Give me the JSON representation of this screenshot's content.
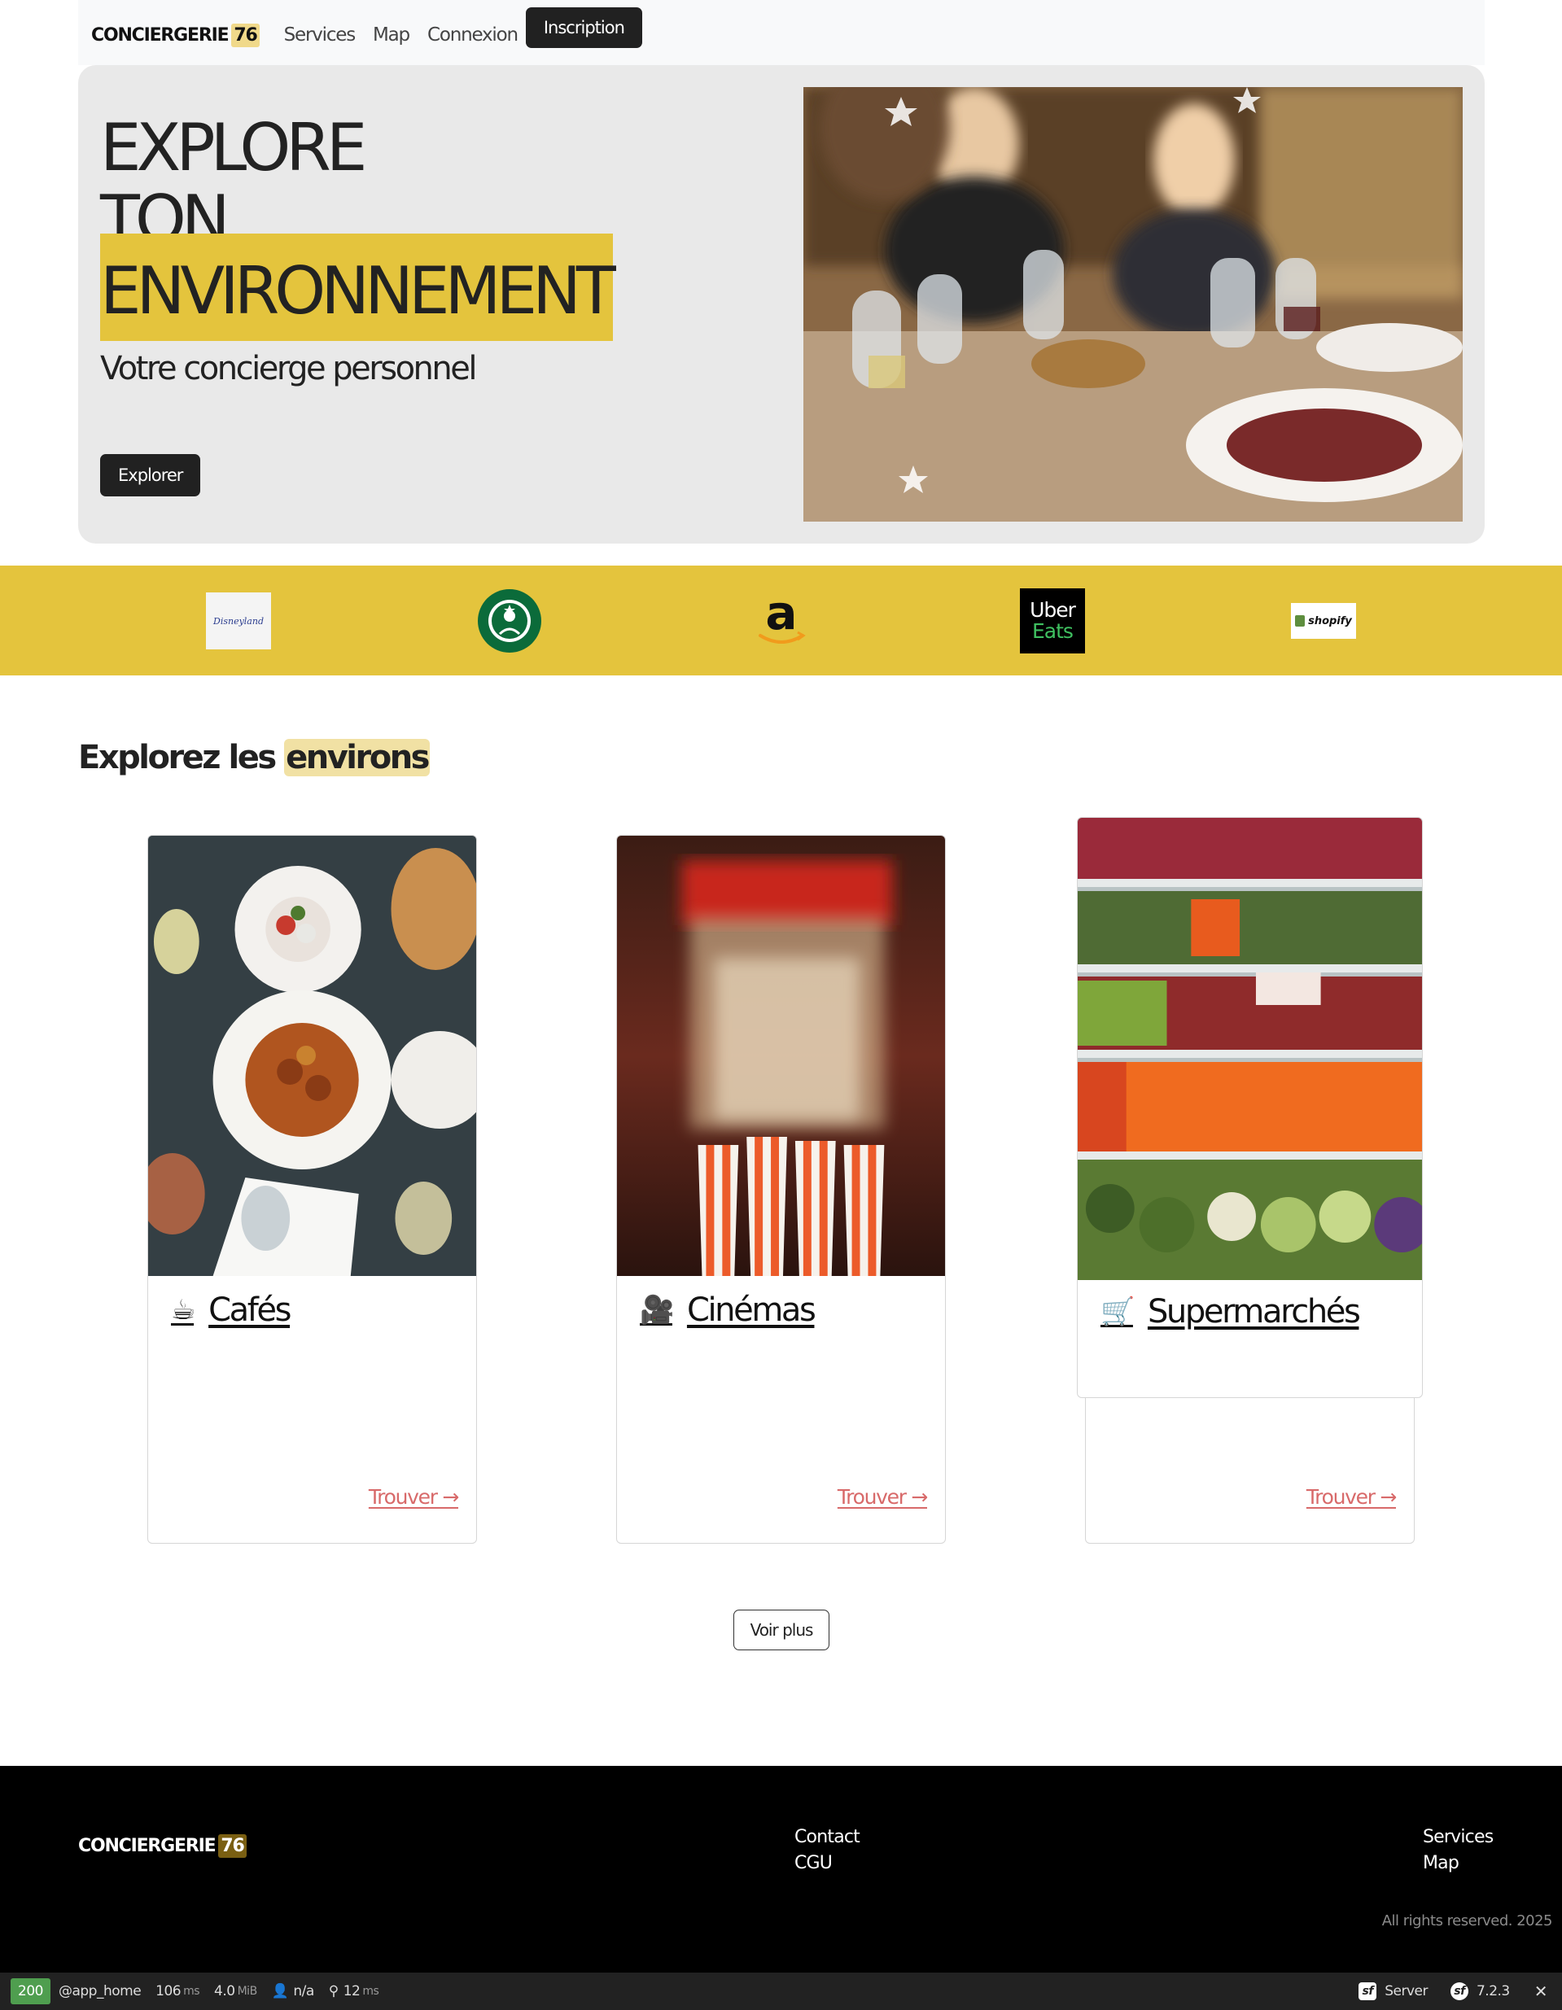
{
  "nav": {
    "brand": "CONCIERGERIE",
    "brand_badge": "76",
    "links": [
      "Services",
      "Map",
      "Connexion"
    ],
    "cta": "Inscription"
  },
  "hero": {
    "title_line1": "EXPLORE",
    "title_line2": "TON",
    "title_highlight": "ENVIRONNEMENT",
    "subtitle": "Votre concierge personnel",
    "button": "Explorer"
  },
  "partners": {
    "amazon": "a",
    "uber_line1": "Uber",
    "uber_line2": "Eats",
    "shopify": "shopify",
    "disneyland": "Disneyland"
  },
  "explore": {
    "title_prefix": "Explorez les",
    "title_highlight": "environs",
    "cards": [
      {
        "icon": "☕",
        "title": "Cafés",
        "link": "Trouver →"
      },
      {
        "icon": "🎥",
        "title": "Cinémas",
        "link": "Trouver →"
      },
      {
        "icon": "🛒",
        "title": "Supermarchés",
        "link": "Trouver →"
      }
    ],
    "more": "Voir plus"
  },
  "footer": {
    "brand": "CONCIERGERIE",
    "brand_badge": "76",
    "col1": [
      "Contact",
      "CGU"
    ],
    "col2": [
      "Services",
      "Map"
    ],
    "copyright": "All rights reserved. 2025"
  },
  "toolbar": {
    "status": "200",
    "route": "@app_home",
    "time": "106",
    "time_unit": "ms",
    "memory": "4.0",
    "memory_unit": "MiB",
    "user": "n/a",
    "requests": "12",
    "requests_unit": "ms",
    "server": "Server",
    "version": "7.2.3"
  },
  "colors": {
    "accent": "#e4c43d",
    "dark": "#212121",
    "link": "#d86a6a",
    "hero_bg": "#e9e9e9"
  }
}
